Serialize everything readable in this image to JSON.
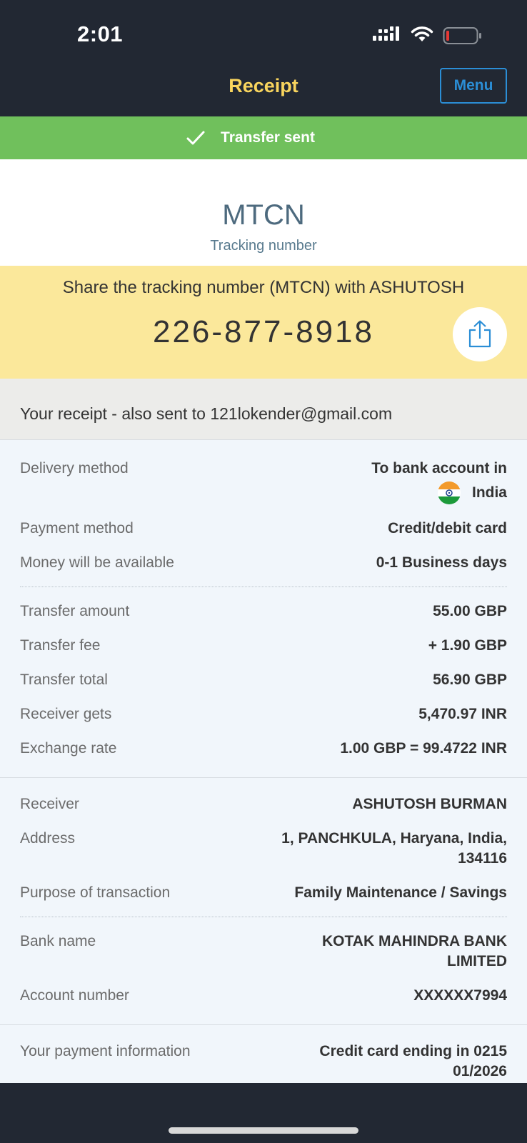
{
  "status_bar": {
    "time": "2:01"
  },
  "nav": {
    "title": "Receipt",
    "menu_label": "Menu"
  },
  "banner": {
    "text": "Transfer sent",
    "color": "#70c05c"
  },
  "mtcn": {
    "title": "MTCN",
    "subtitle": "Tracking number",
    "share_text": "Share the tracking number (MTCN) with ASHUTOSH",
    "number": "226-877-8918"
  },
  "receipt_note": "Your receipt - also sent to 121lokender@gmail.com",
  "details": {
    "delivery_method": {
      "label": "Delivery method",
      "value_line1": "To bank account in",
      "value_line2": "India"
    },
    "payment_method": {
      "label": "Payment method",
      "value": "Credit/debit card"
    },
    "availability": {
      "label": "Money will be available",
      "value": "0-1 Business days"
    },
    "transfer_amount": {
      "label": "Transfer amount",
      "value": "55.00 GBP"
    },
    "transfer_fee": {
      "label": "Transfer fee",
      "value": "+ 1.90 GBP"
    },
    "transfer_total": {
      "label": "Transfer total",
      "value": "56.90 GBP"
    },
    "receiver_gets": {
      "label": "Receiver gets",
      "value": "5,470.97 INR"
    },
    "exchange_rate": {
      "label": "Exchange rate",
      "value": "1.00 GBP = 99.4722 INR"
    },
    "receiver": {
      "label": "Receiver",
      "value": "ASHUTOSH BURMAN"
    },
    "address": {
      "label": "Address",
      "value_line1": "1, PANCHKULA, Haryana, India,",
      "value_line2": "134116"
    },
    "purpose": {
      "label": "Purpose of transaction",
      "value": "Family Maintenance / Savings"
    },
    "bank_name": {
      "label": "Bank name",
      "value_line1": "KOTAK MAHINDRA BANK",
      "value_line2": "LIMITED"
    },
    "account_number": {
      "label": "Account number",
      "value": "XXXXXX7994"
    },
    "payment_info": {
      "label": "Your payment information",
      "value_line1": "Credit card ending in 0215",
      "value_line2": "01/2026"
    }
  },
  "colors": {
    "dark_bg": "#222833",
    "accent_yellow": "#f9d55e",
    "menu_blue": "#2b8ed6",
    "share_panel": "#fbe89b",
    "details_bg": "#f1f6fb"
  },
  "icons": [
    "signal-icon",
    "wifi-icon",
    "battery-icon",
    "check-icon",
    "share-icon",
    "india-flag-icon"
  ]
}
